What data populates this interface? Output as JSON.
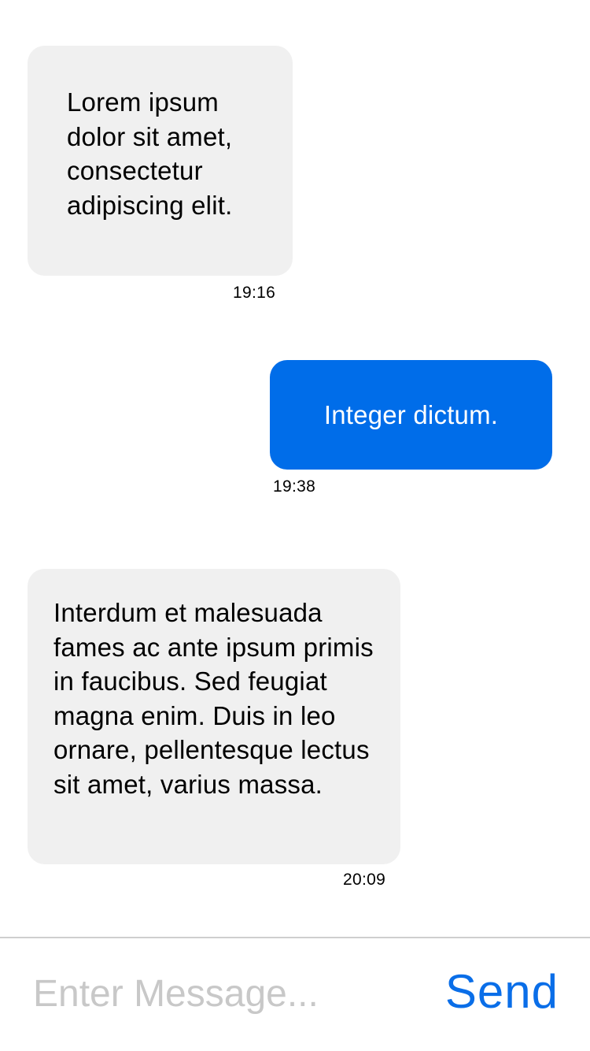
{
  "messages": [
    {
      "direction": "incoming",
      "text": "Lorem ipsum dolor sit amet, consectetur adipiscing elit.",
      "time": "19:16"
    },
    {
      "direction": "outgoing",
      "text": "Integer dictum.",
      "time": "19:38"
    },
    {
      "direction": "incoming",
      "text": "Interdum et malesuada fames ac ante ipsum primis in faucibus. Sed feugiat magna enim. Duis in leo ornare, pellentesque lectus sit amet, varius massa.",
      "time": "20:09"
    }
  ],
  "composer": {
    "placeholder": "Enter Message...",
    "value": "",
    "send_label": "Send"
  },
  "colors": {
    "outgoing_bubble": "#006de9",
    "incoming_bubble": "#f0f0f0",
    "send_button": "#0a6ee8",
    "placeholder": "#c8c8c8"
  }
}
